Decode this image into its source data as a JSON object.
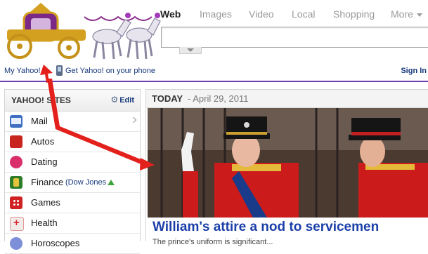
{
  "search": {
    "tabs": [
      {
        "label": "Web",
        "active": true
      },
      {
        "label": "Images"
      },
      {
        "label": "Video"
      },
      {
        "label": "Local"
      },
      {
        "label": "Shopping"
      },
      {
        "label": "More"
      }
    ],
    "query": ""
  },
  "header": {
    "my_yahoo": "My Yahoo!",
    "get_phone": "Get Yahoo! on your phone",
    "sign_in": "Sign In"
  },
  "sidebar": {
    "title": "YAHOO! SITES",
    "edit": "Edit",
    "items": [
      {
        "label": "Mail",
        "icon": "mail-icon"
      },
      {
        "label": "Autos",
        "icon": "car-icon"
      },
      {
        "label": "Dating",
        "icon": "heart-icon"
      },
      {
        "label": "Finance",
        "icon": "finance-icon",
        "extra": "(Dow Jones"
      },
      {
        "label": "Games",
        "icon": "dice-icon"
      },
      {
        "label": "Health",
        "icon": "health-cross-icon"
      },
      {
        "label": "Horoscopes",
        "icon": "horoscope-icon"
      }
    ]
  },
  "main": {
    "today_label": "TODAY",
    "today_date": "- April 29, 2011",
    "headline": "William's attire a nod to servicemen",
    "teaser": "The prince's uniform is significant..."
  },
  "colors": {
    "link": "#16387c",
    "headline": "#1b3fa8",
    "header_rule": "#6c3bb0",
    "annotation_arrow": "#e3201b"
  }
}
